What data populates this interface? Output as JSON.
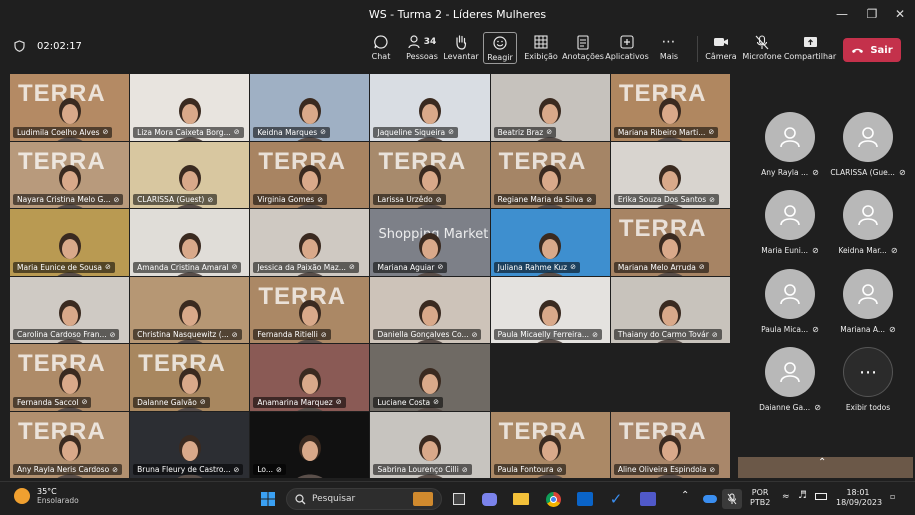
{
  "window": {
    "title": "WS - Turma 2 - Líderes Mulheres"
  },
  "meeting": {
    "elapsed": "02:02:17"
  },
  "toolbar": {
    "chat": "Chat",
    "people": "Pessoas",
    "people_count": "34",
    "raise": "Levantar",
    "react": "Reagir",
    "view": "Exibição",
    "notes": "Anotações",
    "apps": "Aplicativos",
    "more": "Mais",
    "camera": "Câmera",
    "mic": "Microfone",
    "share": "Compartilhar",
    "leave": "Sair"
  },
  "grid": {
    "wordmark": "TERRA",
    "tiles": [
      {
        "name": "Ludimila Coelho Alves",
        "bg": "#b48a64",
        "brand": true
      },
      {
        "name": "Liza Mora Caixeta Borg...",
        "bg": "#e8e4df",
        "brand": false
      },
      {
        "name": "Keidna Marques",
        "bg": "#9fb0c4",
        "brand": false
      },
      {
        "name": "Jaqueline Siqueira",
        "bg": "#d9dde3",
        "brand": false
      },
      {
        "name": "Beatriz Braz",
        "bg": "#c6c2bd",
        "brand": false
      },
      {
        "name": "Mariana Ribeiro Marti...",
        "bg": "#b08760",
        "brand": true
      },
      {
        "name": "Nayara Cristina Melo G...",
        "bg": "#b89a7c",
        "brand": true
      },
      {
        "name": "CLARISSA (Guest)",
        "bg": "#d8c7a0",
        "brand": false
      },
      {
        "name": "Virginia Gomes",
        "bg": "#a88462",
        "brand": true
      },
      {
        "name": "Larissa Urzêdo",
        "bg": "#a78a6c",
        "brand": true
      },
      {
        "name": "Regiane Maria da Silva",
        "bg": "#a58566",
        "brand": true
      },
      {
        "name": "Erika Souza Dos Santos",
        "bg": "#d8d4cf",
        "brand": false
      },
      {
        "name": "Maria Eunice de Sousa",
        "bg": "#b99a52",
        "brand": false
      },
      {
        "name": "Amanda Cristina Amaral",
        "bg": "#e0ddd8",
        "brand": false
      },
      {
        "name": "Jessica da Paixão Maz...",
        "bg": "#cfc9c2",
        "brand": false
      },
      {
        "name": "Mariana Aguiar",
        "bg": "#7d8088",
        "brand": false,
        "overlay": "Shopping Market"
      },
      {
        "name": "Juliana Rahme Kuz",
        "bg": "#3e8fcf",
        "brand": false
      },
      {
        "name": "Mariana Melo Arruda",
        "bg": "#a78464",
        "brand": true
      },
      {
        "name": "Carolina Cardoso Fran...",
        "bg": "#cfcac4",
        "brand": false
      },
      {
        "name": "Christina Nasquewitz (...",
        "bg": "#b69774",
        "brand": false
      },
      {
        "name": "Fernanda Ritielli",
        "bg": "#ab8865",
        "brand": true
      },
      {
        "name": "Daniella Gonçalves Co...",
        "bg": "#cdc3b9",
        "brand": false
      },
      {
        "name": "Paula Micaelly Ferreira...",
        "bg": "#e4e2df",
        "brand": false
      },
      {
        "name": "Thaiany do Carmo Továr",
        "bg": "#c8c3bc",
        "brand": false
      },
      {
        "name": "Fernanda Saccol",
        "bg": "#ae8b68",
        "brand": true
      },
      {
        "name": "Dalanne Galvão",
        "bg": "#a8875f",
        "brand": true
      },
      {
        "name": "Anamarina Marquez",
        "bg": "#8a5a55",
        "brand": false
      },
      {
        "name": "Luciane Costa",
        "bg": "#6f6a64",
        "brand": false
      },
      {
        "name": "",
        "bg": "#1f1f1f",
        "brand": false,
        "empty": true
      },
      {
        "name": "",
        "bg": "#1f1f1f",
        "brand": false,
        "empty": true
      },
      {
        "name": "Any Rayla Neris Cardoso",
        "bg": "#b1906f",
        "brand": true
      },
      {
        "name": "Bruna Fleury de Castro...",
        "bg": "#2c2e33",
        "brand": false
      },
      {
        "name": "Lo...",
        "bg": "#111111",
        "brand": false
      },
      {
        "name": "Sabrina Lourenço Cilli",
        "bg": "#c7c4bf",
        "brand": false
      },
      {
        "name": "Paula Fontoura",
        "bg": "#ab8966",
        "brand": true
      },
      {
        "name": "Aline Oliveira Espindola",
        "bg": "#a9876a",
        "brand": true
      }
    ]
  },
  "roster": [
    {
      "name": "Any Rayla ..."
    },
    {
      "name": "CLARISSA (Gue..."
    },
    {
      "name": "Maria Euni..."
    },
    {
      "name": "Keidna Mar..."
    },
    {
      "name": "Paula Mica..."
    },
    {
      "name": "Mariana A..."
    },
    {
      "name": "Daianne Ga..."
    }
  ],
  "roster_more": "Exibir todos",
  "taskbar": {
    "temp": "35°C",
    "weather": "Ensolarado",
    "search_placeholder": "Pesquisar",
    "lang1": "POR",
    "lang2": "PTB2",
    "time": "18:01",
    "date": "18/09/2023"
  },
  "colors": {
    "leave": "#c4314b",
    "bg": "#1f1f1f"
  }
}
